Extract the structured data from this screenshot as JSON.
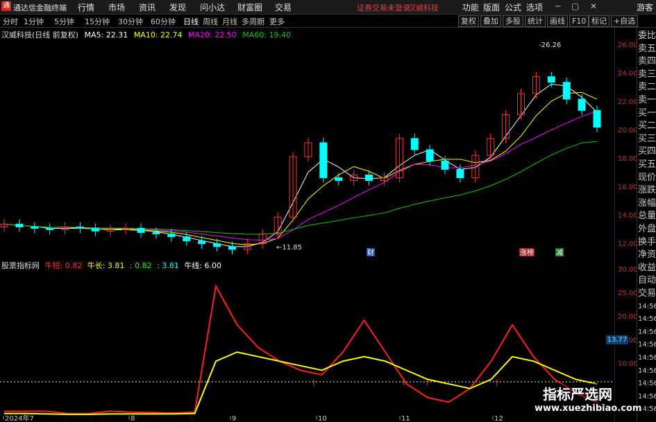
{
  "menubar": {
    "logo": "通",
    "app_title": "通达信金融终端",
    "items": [
      "行情",
      "市场",
      "资讯",
      "发现",
      "问小达",
      "财富圈",
      "交易"
    ],
    "login_notice": "证券交易未登录",
    "stock_name_top": "汉威科技",
    "right_items": [
      "功能",
      "版面",
      "公式",
      "选项"
    ],
    "guest": "游客"
  },
  "periods": [
    "分时",
    "1分钟",
    "5分钟",
    "15分钟",
    "30分钟",
    "60分钟",
    "日线",
    "周线",
    "月线",
    "多周期",
    "更多"
  ],
  "active_period": "日线",
  "right_tabs": [
    "复权",
    "叠加",
    "多股",
    "统计",
    "画线",
    "F10",
    "标记",
    "+自选"
  ],
  "main": {
    "stock_label": "汉威科技(日线 前复权)",
    "ma5": "MA5: 22.31",
    "ma10": "MA10: 22.74",
    "ma20": "MA20: 22.50",
    "ma60": "MA60: 19.40",
    "high_label": "26.26",
    "low_label": "11.85",
    "y_ticks": [
      "26.00",
      "24.00",
      "22.00",
      "20.00",
      "18.00",
      "16.00",
      "14.00",
      "12.00"
    ],
    "event_tags": [
      "财",
      "涨榜",
      "减"
    ]
  },
  "indicator": {
    "name": "股票指标网",
    "short": "牛短: 0.82",
    "long": "牛长: 3.81",
    "v1": ": 0.82",
    "v2": ": 3.81",
    "line": "牛线: 6.00",
    "y_ticks": [
      "30.00",
      "25.00",
      "20.00",
      "15.00",
      "10.00"
    ],
    "current_value": "13.77"
  },
  "x_axis": [
    "2024年7",
    "8",
    "9",
    "10",
    "11",
    "12"
  ],
  "sidebar": [
    "委比",
    "卖五",
    "卖四",
    "卖三",
    "卖二",
    "卖一",
    "买一",
    "买二",
    "买三",
    "买四",
    "买五",
    "现价",
    "涨跌",
    "涨幅",
    "总量",
    "外盘",
    "换手",
    "净资",
    "收益",
    "自动",
    "交易",
    "14:56",
    "14:56",
    "14:56",
    "14:56",
    "14:56",
    "14:56",
    "14:56",
    "14:56",
    "14:56"
  ],
  "watermark": {
    "title": "指标严选网",
    "url": "www.xuezhibiao.com"
  },
  "colors": {
    "up": "#ff3333",
    "down": "#00ffff",
    "ma5": "#ffffff",
    "ma10": "#ffff00",
    "ma20": "#ff00ff",
    "ma60": "#00cc00",
    "axis": "#7a0000"
  },
  "chart_data": {
    "type": "candlestick",
    "x": [
      "2024-07",
      "2024-08",
      "2024-09",
      "2024-10",
      "2024-11",
      "2024-12"
    ],
    "ylim": [
      11.5,
      26.8
    ],
    "close_approx": [
      13.7,
      13.5,
      13.4,
      13.3,
      13.5,
      13.4,
      13.2,
      13.3,
      13.4,
      13.1,
      13.0,
      12.8,
      12.5,
      12.3,
      12.1,
      11.9,
      12.3,
      13.0,
      14.2,
      18.5,
      19.5,
      17.0,
      16.8,
      17.2,
      16.8,
      17.0,
      19.8,
      19.0,
      18.2,
      17.6,
      17.0,
      18.6,
      19.8,
      21.5,
      23.0,
      24.2,
      23.8,
      22.6,
      21.8,
      20.6
    ],
    "indicator_ylim": [
      0,
      32
    ],
    "indicator_series": [
      {
        "name": "牛短",
        "values": [
          1,
          1,
          1,
          0.5,
          0.5,
          1,
          0.8,
          0.7,
          0.6,
          0.8,
          28.5,
          20,
          15,
          12,
          10,
          9,
          14,
          21,
          14,
          7,
          4,
          3,
          6,
          12,
          20,
          13,
          8,
          5,
          3
        ]
      },
      {
        "name": "牛长",
        "values": [
          0.5,
          0.5,
          0.4,
          0.3,
          0.3,
          0.4,
          0.4,
          0.4,
          0.4,
          0.5,
          12,
          14,
          13,
          12,
          11,
          10,
          12,
          13,
          12,
          10,
          8,
          7,
          6,
          8,
          13,
          12,
          10,
          8,
          7
        ]
      }
    ]
  }
}
